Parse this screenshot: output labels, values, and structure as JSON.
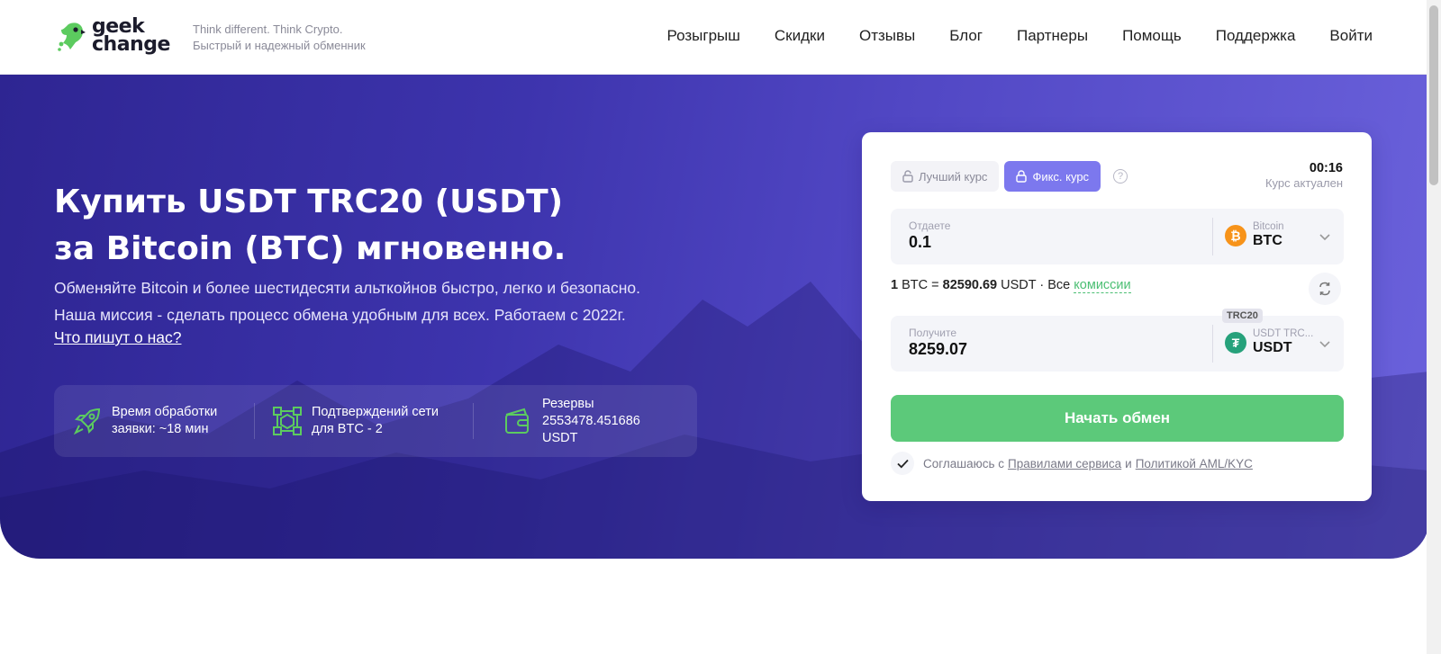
{
  "header": {
    "logo_line1": "geek",
    "logo_line2": "change",
    "tagline1": "Think different. Think Crypto.",
    "tagline2": "Быстрый и надежный обменник",
    "nav": [
      "Розыгрыш",
      "Скидки",
      "Отзывы",
      "Блог",
      "Партнеры",
      "Помощь",
      "Поддержка",
      "Войти"
    ]
  },
  "hero": {
    "title_line1": "Купить USDT TRC20 (USDT)",
    "title_line2": "за Bitcoin (BTC) мгновенно.",
    "subtitle_line1": "Обменяйте Bitcoin и более шестидесяти альткойнов быстро, легко и безопасно.",
    "subtitle_line2": "Наша миссия - сделать процесс обмена удобным для всех. Работаем с 2022г.",
    "reviews_link": "Что пишут о нас?",
    "stats": [
      {
        "line1": "Время обработки",
        "line2": "заявки: ~18 мин",
        "line3": ""
      },
      {
        "line1": "Подтверждений сети",
        "line2": "для BTC - 2",
        "line3": ""
      },
      {
        "line1": "Резервы",
        "line2": "2553478.451686",
        "line3": "USDT"
      }
    ]
  },
  "exchange": {
    "tab_best": "Лучший курс",
    "tab_fixed": "Фикс. курс",
    "help": "?",
    "timer": "00:16",
    "timer_note": "Курс актуален",
    "give": {
      "label": "Отдаете",
      "value": "0.1",
      "network": "Bitcoin",
      "code": "BTC",
      "icon": "₿",
      "color": "#f7931a"
    },
    "rate": {
      "lhs_amount": "1",
      "lhs_code": "BTC =",
      "rhs_amount": "82590.69",
      "rhs_code": "USDT ·",
      "all": "Все",
      "fees_link": "комиссии"
    },
    "receive": {
      "label": "Получите",
      "value": "8259.07",
      "network": "USDT TRC...",
      "code": "USDT",
      "icon": "₮",
      "color": "#26a17b",
      "badge": "TRC20"
    },
    "submit": "Начать обмен",
    "agree_prefix": "Соглашаюсь с",
    "agree_rules": "Правилами сервиса",
    "agree_and": "и",
    "agree_aml": "Политикой AML/KYC"
  }
}
